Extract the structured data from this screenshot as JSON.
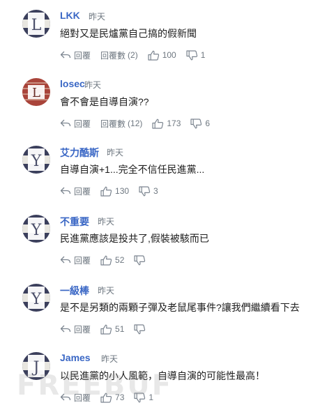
{
  "ui": {
    "reply_label": "回覆",
    "replies_label_prefix": "回覆數",
    "watermark": "FREEBUF"
  },
  "comments": [
    {
      "username": "LKK",
      "time": "昨天",
      "text": "絕對又是民爐黨自己搞的假新聞",
      "reply_count": "(2)",
      "likes": "100",
      "dislikes": "1",
      "avatar_letter": "L",
      "avatar_style": "navy",
      "has_replies": true
    },
    {
      "username": "losec",
      "time": "昨天",
      "text": "會不會是自導自演??",
      "reply_count": "(12)",
      "likes": "173",
      "dislikes": "6",
      "avatar_letter": "L",
      "avatar_style": "brick",
      "has_replies": true
    },
    {
      "username": "艾力酷斯",
      "time": "昨天",
      "text": "自導自演+1...完全不信任民進黨...",
      "likes": "130",
      "dislikes": "3",
      "avatar_letter": "Y",
      "avatar_style": "navy",
      "has_replies": false
    },
    {
      "username": "不重要",
      "time": "昨天",
      "text": "民進黨應該是投共了,假裝被駭而已",
      "likes": "52",
      "dislikes": "",
      "avatar_letter": "Y",
      "avatar_style": "navy",
      "has_replies": false
    },
    {
      "username": "一級棒",
      "time": "昨天",
      "text": "是不是另類的兩顆子彈及老鼠尾事件?讓我們繼續看下去",
      "likes": "51",
      "dislikes": "",
      "avatar_letter": "Y",
      "avatar_style": "navy",
      "has_replies": false
    },
    {
      "username": "James",
      "time": "昨天",
      "text": "以民進黨的小人風範，自導自演的可能性最高！",
      "likes": "73",
      "dislikes": "1",
      "avatar_letter": "J",
      "avatar_style": "navy",
      "has_replies": false
    }
  ],
  "colors": {
    "username": "#3a67c5",
    "meta": "#6e7780",
    "text": "#1d1d1d",
    "avatar_navy": "#3b3f5c",
    "avatar_brick": "#a9443a"
  },
  "icons": [
    "reply-icon",
    "thumbs-up-icon",
    "thumbs-down-icon"
  ]
}
